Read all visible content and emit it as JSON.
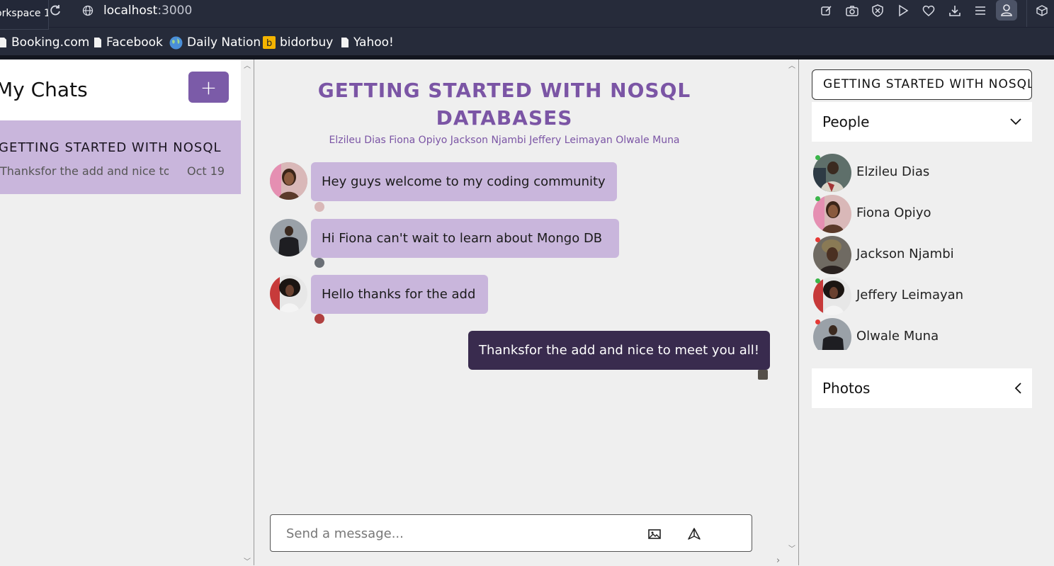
{
  "browser": {
    "workspace_tab": "orkspace 1",
    "url_host": "localhost",
    "url_port": ":3000",
    "bookmarks": [
      {
        "label": "Booking.com",
        "icon": "page-icon"
      },
      {
        "label": "Facebook",
        "icon": "page-icon"
      },
      {
        "label": "Daily Nation",
        "icon": "globe-icon"
      },
      {
        "label": "bidorbuy",
        "icon": "bidorbuy-icon"
      },
      {
        "label": "Yahoo!",
        "icon": "page-icon"
      }
    ]
  },
  "sidebar": {
    "title": "My Chats",
    "add_button": "+",
    "chats": [
      {
        "title": "GETTING STARTED WITH NOSQL DATABASES",
        "preview": "Thanksfor the add and nice to meet you all!",
        "date": "Oct 19"
      }
    ]
  },
  "chat": {
    "title": "GETTING STARTED WITH NOSQL DATABASES",
    "members": "Elzileu Dias Fiona Opiyo Jackson Njambi Jeffery Leimayan Olwale Muna",
    "messages": [
      {
        "text": "Hey guys welcome to my coding community",
        "sender": "Fiona Opiyo",
        "own": false
      },
      {
        "text": "Hi Fiona can't wait to learn about Mongo DB",
        "sender": "Olwale Muna",
        "own": false
      },
      {
        "text": "Hello thanks for the add",
        "sender": "Jeffery Leimayan",
        "own": false
      },
      {
        "text": "Thanksfor the add and nice to meet you all!",
        "sender": "Elzileu Dias",
        "own": true
      }
    ],
    "input_placeholder": "Send a message..."
  },
  "details": {
    "title_field": "GETTING STARTED WITH NOSQL DATABASES",
    "people_label": "People",
    "photos_label": "Photos",
    "people": [
      {
        "name": "Elzileu Dias",
        "status": "online",
        "status_color": "#3bb54a"
      },
      {
        "name": "Fiona Opiyo",
        "status": "online",
        "status_color": "#3bb54a"
      },
      {
        "name": "Jackson Njambi",
        "status": "offline",
        "status_color": "#e53935"
      },
      {
        "name": "Jeffery Leimayan",
        "status": "online",
        "status_color": "#3bb54a"
      },
      {
        "name": "Olwale Muna",
        "status": "offline",
        "status_color": "#e53935"
      }
    ]
  },
  "colors": {
    "accent": "#7b5ba8",
    "bubble_other": "#c9b6dc",
    "bubble_own": "#392b4e",
    "chrome": "#262b3a"
  }
}
